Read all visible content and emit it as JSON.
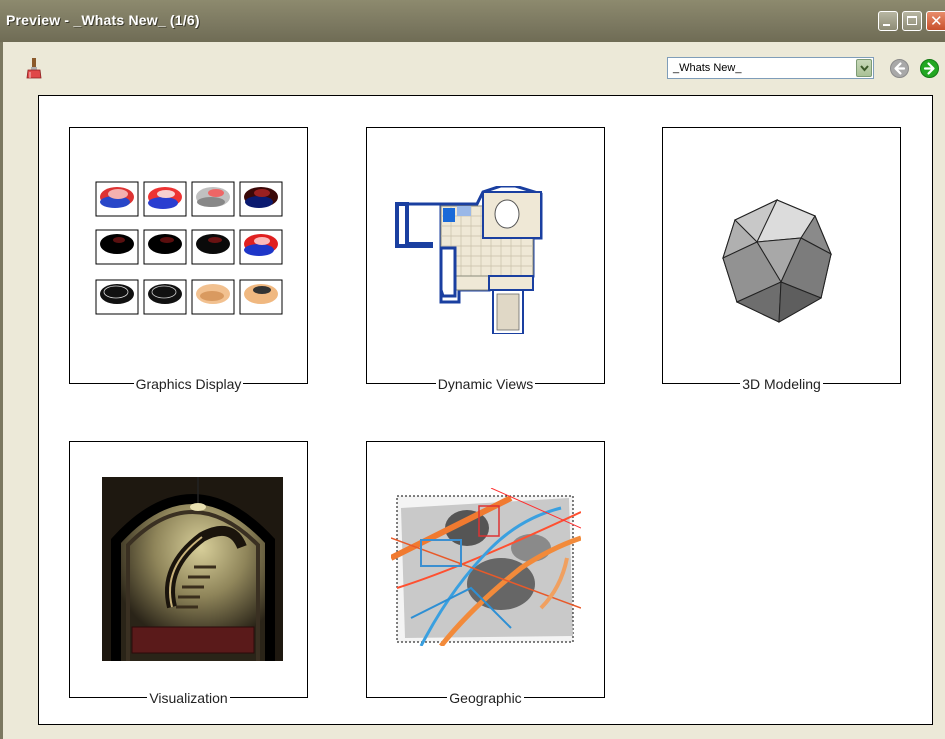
{
  "window": {
    "title": "Preview - _Whats New_  (1/6)"
  },
  "toolbar": {
    "selector_value": "_Whats New_"
  },
  "tiles": [
    {
      "label": "Graphics Display"
    },
    {
      "label": "Dynamic Views"
    },
    {
      "label": "3D Modeling"
    },
    {
      "label": "Visualization"
    },
    {
      "label": "Geographic"
    }
  ],
  "icons": {
    "brush": "paint-brush-icon",
    "back": "back-arrow-icon",
    "forward": "forward-arrow-icon",
    "dropdown": "chevron-down-icon",
    "minimize": "minimize-icon",
    "maximize": "maximize-icon",
    "close": "close-icon"
  },
  "colors": {
    "titlebar": "#7b7860",
    "close": "#c8502c",
    "forward": "#1fa51f",
    "back": "#9a9a9a"
  }
}
